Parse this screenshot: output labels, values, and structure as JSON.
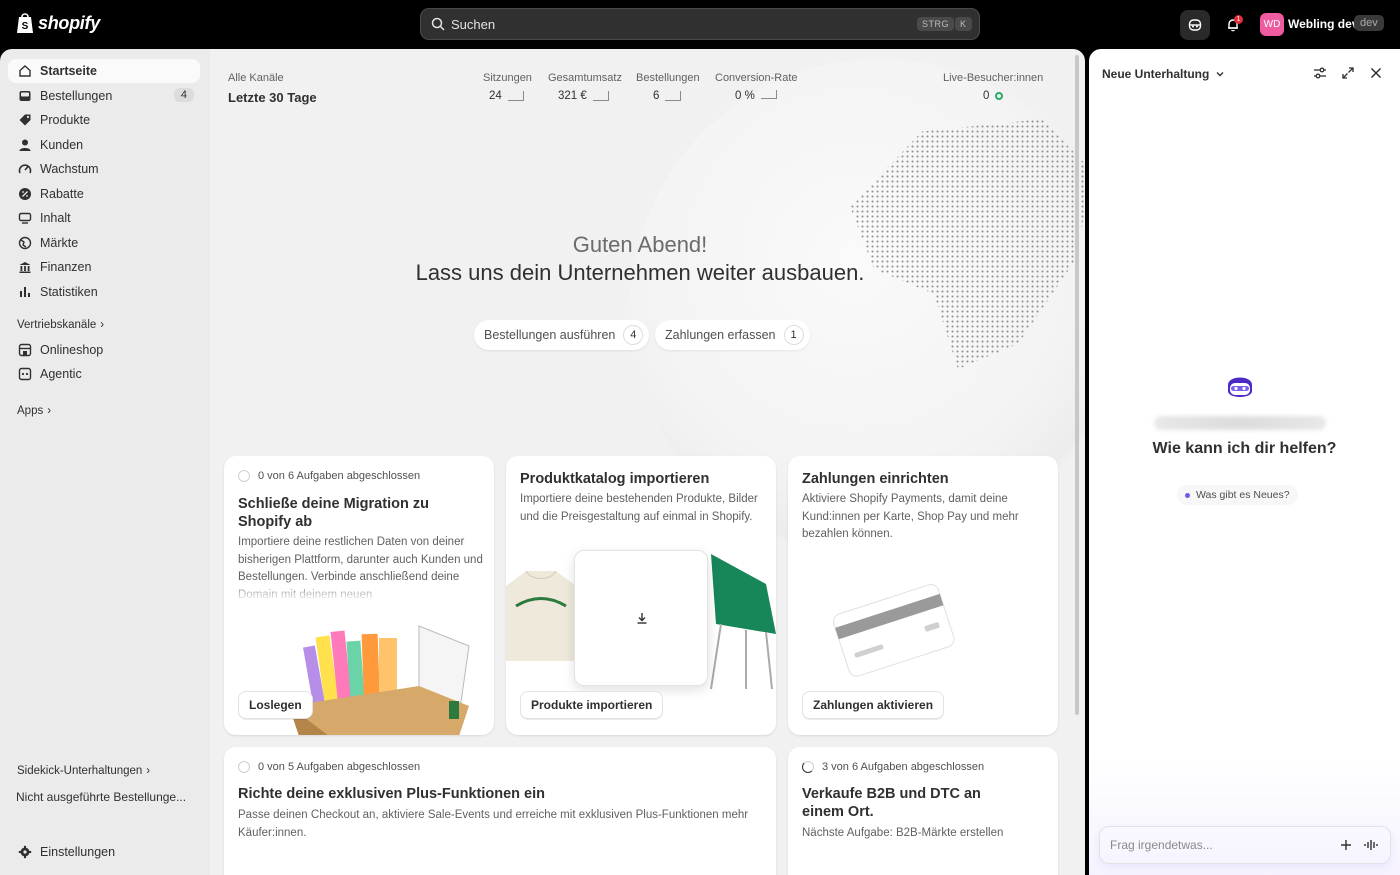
{
  "topbar": {
    "logo_text": "shopify",
    "search_placeholder": "Suchen",
    "kbd1": "STRG",
    "kbd2": "K",
    "notification_count": "1",
    "avatar_initials": "WD",
    "store_name": "Webling dev",
    "store_tag": "dev"
  },
  "sidebar": {
    "items": [
      {
        "label": "Startseite",
        "icon": "home-icon"
      },
      {
        "label": "Bestellungen",
        "icon": "inbox-icon",
        "count": "4"
      },
      {
        "label": "Produkte",
        "icon": "tag-icon"
      },
      {
        "label": "Kunden",
        "icon": "person-icon"
      },
      {
        "label": "Wachstum",
        "icon": "gauge-icon"
      },
      {
        "label": "Rabatte",
        "icon": "discount-icon"
      },
      {
        "label": "Inhalt",
        "icon": "content-icon"
      },
      {
        "label": "Märkte",
        "icon": "globe-icon"
      },
      {
        "label": "Finanzen",
        "icon": "bank-icon"
      },
      {
        "label": "Statistiken",
        "icon": "chart-icon"
      }
    ],
    "sales_channels_label": "Vertriebskanäle",
    "channels": [
      {
        "label": "Onlineshop",
        "icon": "store-icon"
      },
      {
        "label": "Agentic",
        "icon": "agent-icon"
      }
    ],
    "apps_label": "Apps",
    "sidekick_label": "Sidekick-Unterhaltungen",
    "conversation_label": "Nicht ausgeführte Bestellunge...",
    "settings_label": "Einstellungen"
  },
  "stats": {
    "channel_label": "Alle Kanäle",
    "period_label": "Letzte 30 Tage",
    "metrics": [
      {
        "label": "Sitzungen",
        "value": "24"
      },
      {
        "label": "Gesamtumsatz",
        "value": "321 €"
      },
      {
        "label": "Bestellungen",
        "value": "6"
      },
      {
        "label": "Conversion-Rate",
        "value": "0 %"
      }
    ],
    "live_label": "Live-Besucher:innen",
    "live_value": "0"
  },
  "greeting": {
    "line1": "Guten Abend!",
    "line2": "Lass uns dein Unternehmen weiter ausbauen."
  },
  "actions": [
    {
      "label": "Bestellungen ausführen",
      "count": "4"
    },
    {
      "label": "Zahlungen erfassen",
      "count": "1"
    }
  ],
  "cards": {
    "migration": {
      "progress": "0 von 6 Aufgaben abgeschlossen",
      "title": "Schließe deine Migration zu Shopify ab",
      "desc": "Importiere deine restlichen Daten von deiner bisherigen Plattform, darunter auch Kunden und Bestellungen. Verbinde anschließend deine Domain mit deinem neuen",
      "button": "Loslegen"
    },
    "catalog": {
      "title": "Produktkatalog importieren",
      "desc": "Importiere deine bestehenden Produkte, Bilder und die Preisgestaltung auf einmal in Shopify.",
      "button": "Produkte importieren"
    },
    "payments": {
      "title": "Zahlungen einrichten",
      "desc": "Aktiviere Shopify Payments, damit deine Kund:innen per Karte, Shop Pay und mehr bezahlen können.",
      "button": "Zahlungen aktivieren"
    },
    "plus": {
      "progress": "0 von 5 Aufgaben abgeschlossen",
      "title": "Richte deine exklusiven Plus-Funktionen ein",
      "desc": "Passe deinen Checkout an, aktiviere Sale-Events und erreiche mit exklusiven Plus-Funktionen mehr Käufer:innen."
    },
    "b2b": {
      "progress": "3 von 6 Aufgaben abgeschlossen",
      "title": "Verkaufe B2B und DTC an einem Ort.",
      "desc": "Nächste Aufgabe: B2B-Märkte erstellen"
    }
  },
  "sidekick": {
    "title": "Neue Unterhaltung",
    "help": "Wie kann ich dir helfen?",
    "suggestion": "Was gibt es Neues?",
    "input_placeholder": "Frag irgendetwas..."
  }
}
